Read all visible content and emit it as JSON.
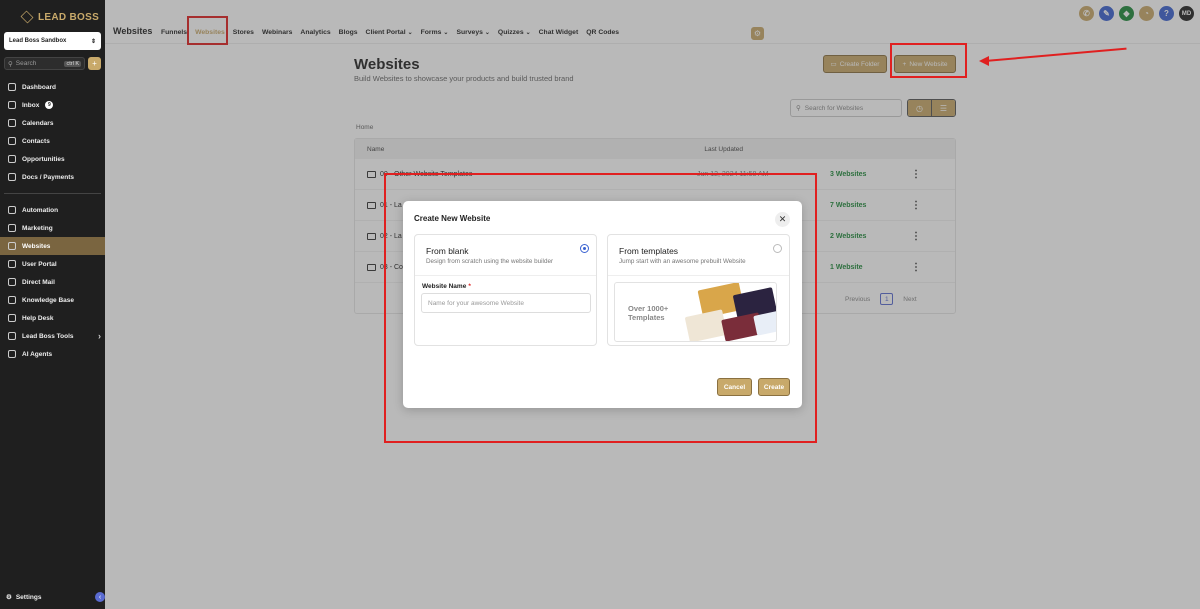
{
  "brand": {
    "logo_text": "LEAD BOSS"
  },
  "account": {
    "name": "Lead Boss Sandbox"
  },
  "sidebar": {
    "search_placeholder": "Search",
    "search_shortcut": "ctrl K",
    "items_top": [
      {
        "label": "Dashboard"
      },
      {
        "label": "Inbox",
        "badge": "9"
      },
      {
        "label": "Calendars"
      },
      {
        "label": "Contacts"
      },
      {
        "label": "Opportunities"
      },
      {
        "label": "Docs / Payments"
      }
    ],
    "items_bottom": [
      {
        "label": "Automation"
      },
      {
        "label": "Marketing"
      },
      {
        "label": "Websites"
      },
      {
        "label": "User Portal"
      },
      {
        "label": "Direct Mail"
      },
      {
        "label": "Knowledge Base"
      },
      {
        "label": "Help Desk"
      },
      {
        "label": "Lead Boss Tools"
      },
      {
        "label": "AI Agents"
      }
    ],
    "settings_label": "Settings"
  },
  "topnav": {
    "section_title": "Websites",
    "tabs": [
      {
        "label": "Funnels"
      },
      {
        "label": "Websites"
      },
      {
        "label": "Stores"
      },
      {
        "label": "Webinars"
      },
      {
        "label": "Analytics"
      },
      {
        "label": "Blogs"
      },
      {
        "label": "Client Portal"
      },
      {
        "label": "Forms"
      },
      {
        "label": "Surveys"
      },
      {
        "label": "Quizzes"
      },
      {
        "label": "Chat Widget"
      },
      {
        "label": "QR Codes"
      }
    ],
    "user_initials": "MD"
  },
  "page": {
    "title": "Websites",
    "subtitle": "Build Websites to showcase your products and build trusted brand",
    "create_folder_label": "Create Folder",
    "new_website_label": "New Website",
    "search_placeholder": "Search for Websites",
    "breadcrumb": "Home"
  },
  "table": {
    "columns": [
      "Name",
      "Last Updated"
    ],
    "rows": [
      {
        "name": "00 - Other Website Templates",
        "updated": "Jun 12, 2024 11:58 AM",
        "count": "3 Websites"
      },
      {
        "name": "01 - La",
        "updated": "",
        "count": "7 Websites"
      },
      {
        "name": "02 - La",
        "updated": "",
        "count": "2 Websites"
      },
      {
        "name": "03 - Co",
        "updated": "",
        "count": "1 Website"
      }
    ],
    "pager": {
      "prev": "Previous",
      "page": "1",
      "next": "Next"
    }
  },
  "modal": {
    "title": "Create New Website",
    "blank": {
      "title": "From blank",
      "desc": "Design from scratch using the website builder",
      "field_label": "Website Name",
      "required_mark": "*",
      "field_placeholder": "Name for your awesome Website"
    },
    "templates": {
      "title": "From templates",
      "desc": "Jump start with an awesome prebuilt Website",
      "thumb_text": "Over 1000+ Templates"
    },
    "cancel_label": "Cancel",
    "create_label": "Create"
  }
}
